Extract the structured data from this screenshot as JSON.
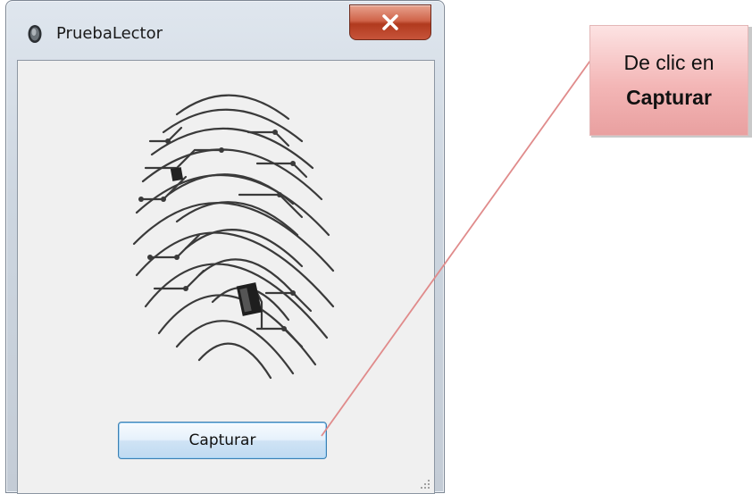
{
  "window": {
    "title": "PruebaLector",
    "close_icon": "close-x-icon",
    "app_icon": "fingerprint-reader-icon"
  },
  "main": {
    "image_icon": "circuit-fingerprint-image",
    "capture_button_label": "Capturar",
    "resize_icon": "resize-grip-icon"
  },
  "callout": {
    "text_line1": "De clic en",
    "text_line2": "Capturar"
  },
  "colors": {
    "callout_top": "#fde3e3",
    "callout_bottom": "#e9a0a0",
    "pointer_line": "#e08b8b",
    "close_button": "#c7543a",
    "button_border": "#3c7fb1"
  }
}
